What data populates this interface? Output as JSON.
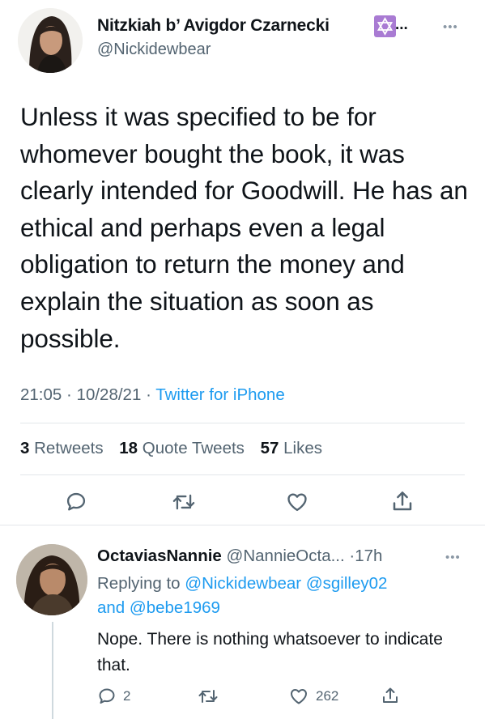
{
  "tweet": {
    "author_name": "Nitzkiah b’ Avigdor Czarnecki",
    "badge_icon": "star-of-david-icon",
    "name_ellipsis": "...",
    "author_handle": "@Nickidewbear",
    "text": "Unless it was specified to be for whomever bought the book, it was clearly intended for Goodwill. He has an ethical and perhaps even a legal obligation to return the money and explain the situation as soon as possible.",
    "time": "21:05",
    "dot": "·",
    "date": "10/28/21",
    "source": "Twitter for iPhone",
    "stats": {
      "retweets_count": "3",
      "retweets_label": "Retweets",
      "quotes_count": "18",
      "quotes_label": "Quote Tweets",
      "likes_count": "57",
      "likes_label": "Likes"
    }
  },
  "reply": {
    "author_name": "OctaviasNannie",
    "author_handle": "@NannieOcta...",
    "time": "·17h",
    "replying_prefix": "Replying to",
    "mention_1": "@Nickidewbear",
    "mention_2": "@sgilley02",
    "mention_and": "and",
    "mention_3": "@bebe1969",
    "text": "Nope. There is nothing whatsoever to indicate that.",
    "reply_count": "2",
    "like_count": "262"
  },
  "colors": {
    "accent": "#1d9bf0",
    "text": "#0f1419",
    "secondary": "#536471",
    "divider": "#e3e7ea",
    "badge": "#a97bd3"
  }
}
